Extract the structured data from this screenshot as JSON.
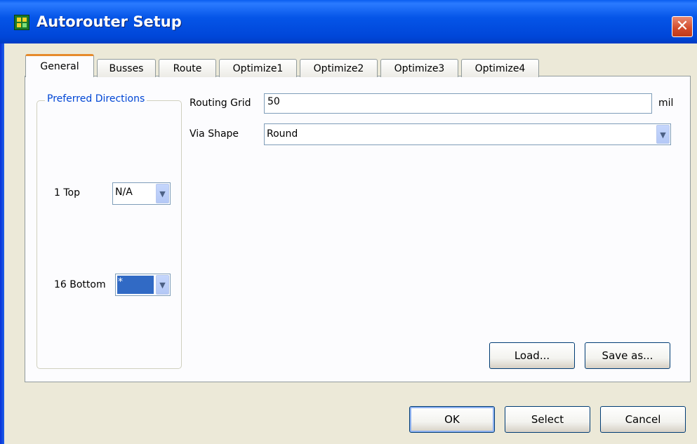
{
  "window": {
    "title": "Autorouter Setup",
    "close_glyph": "✕"
  },
  "tabs": [
    {
      "label": "General",
      "active": true
    },
    {
      "label": "Busses"
    },
    {
      "label": "Route"
    },
    {
      "label": "Optimize1"
    },
    {
      "label": "Optimize2"
    },
    {
      "label": "Optimize3"
    },
    {
      "label": "Optimize4"
    }
  ],
  "preferred_directions": {
    "title": "Preferred Directions",
    "layers": [
      {
        "label": "1  Top",
        "value": "N/A",
        "selected": false
      },
      {
        "label": "16  Bottom",
        "value": "*",
        "selected": true
      }
    ]
  },
  "routing_grid": {
    "label": "Routing Grid",
    "value": "50",
    "unit": "mil"
  },
  "via_shape": {
    "label": "Via Shape",
    "value": "Round"
  },
  "buttons": {
    "load": "Load...",
    "save_as": "Save as...",
    "ok": "OK",
    "select": "Select",
    "cancel": "Cancel"
  },
  "icons": {
    "app": "pcb-board-icon",
    "close": "close-icon",
    "dropdown": "chevron-down-icon"
  },
  "colors": {
    "title_bar": "#0055e5",
    "group_title": "#0046d5",
    "active_tab_accent": "#e68b2c",
    "selection": "#316ac5",
    "close_button": "#d24a2a"
  }
}
